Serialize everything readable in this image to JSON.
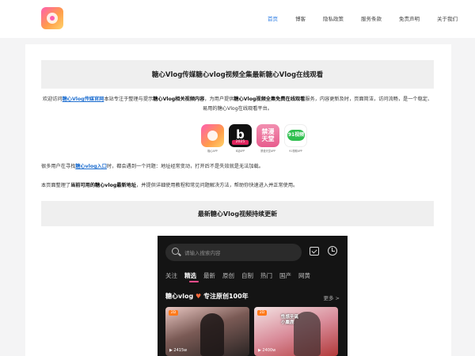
{
  "nav": {
    "items": [
      "首页",
      "博客",
      "隐私政策",
      "服务条款",
      "免责声明",
      "关于我们"
    ],
    "active_index": 0
  },
  "main": {
    "title": "糖心Vlog传媒糖心vlog视频全集最新糖心Vlog在线观看",
    "intro": {
      "p1": "欢迎访问",
      "link1": "糖心Vlog传媒官网",
      "p2": "本站专注于整理与提示",
      "strong1": "糖心Vlog相关视频内容",
      "p3": "，为用户提供",
      "strong2": "糖心Vlog视频全集免费在线观看",
      "p4": "服务，内容更新及时，页面简洁，访问流畅，是一个稳定、易用的糖心Vlog在线观看平台。"
    },
    "apps": [
      {
        "label": "糖心APP"
      },
      {
        "label": "B站APP",
        "badge": "2025"
      },
      {
        "label": "禁漫天堂APP",
        "text": "禁漫\n天堂"
      },
      {
        "label": "91视频APP",
        "text": "91视频"
      }
    ],
    "para2": {
      "p1": "很多用户在寻找",
      "link": "糖心vlog入口",
      "p2": "时，都会遇到一个问题：地址经常变动，打开后不是失效就是无法加载。"
    },
    "para3": {
      "p1": "本页面整理了",
      "strong": "当前可用的糖心vlog最新地址",
      "p2": "，并提供详细使用教程和常见问题解决方法，帮助你快速进入并正常使用。"
    },
    "subtitle": "最新糖心Vlog视频持续更新"
  },
  "phone": {
    "search_placeholder": "请输入搜索内容",
    "tabs": [
      "关注",
      "精选",
      "最新",
      "原创",
      "自制",
      "热门",
      "国产",
      "网黄"
    ],
    "active_tab": 1,
    "section_title": "糖心vlog",
    "section_suffix": "专注原创100年",
    "more": "更多 >",
    "thumbs": [
      {
        "badge": "2D",
        "count": "▶ 2415w"
      },
      {
        "badge": "2D",
        "text": "性感圣诞\n小麋鹿",
        "count": "▶ 2400w"
      }
    ]
  },
  "colors": {
    "accent": "#2a7be4",
    "link": "#1f6fd0",
    "pink": "#ff4d8d"
  }
}
